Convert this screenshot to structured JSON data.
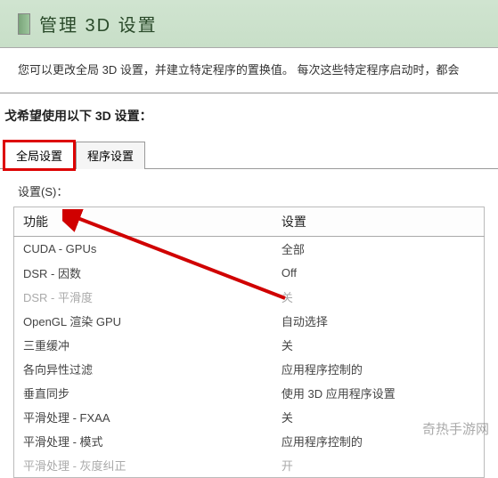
{
  "title": "管理 3D 设置",
  "description": "您可以更改全局 3D 设置，并建立特定程序的置换值。 每次这些特定程序启动时，都会",
  "subsection_label": "戈希望使用以下 3D 设置：",
  "tabs": {
    "global": "全局设置",
    "program": "程序设置"
  },
  "settings_label": "设置(S)：",
  "table": {
    "header_feature": "功能",
    "header_setting": "设置",
    "rows": [
      {
        "feature": "CUDA - GPUs",
        "value": "全部",
        "disabled": false
      },
      {
        "feature": "DSR - 因数",
        "value": "Off",
        "disabled": false
      },
      {
        "feature": "DSR - 平滑度",
        "value": "关",
        "disabled": true
      },
      {
        "feature": "OpenGL 渲染 GPU",
        "value": "自动选择",
        "disabled": false
      },
      {
        "feature": "三重缓冲",
        "value": "关",
        "disabled": false
      },
      {
        "feature": "各向异性过滤",
        "value": "应用程序控制的",
        "disabled": false
      },
      {
        "feature": "垂直同步",
        "value": "使用 3D 应用程序设置",
        "disabled": false
      },
      {
        "feature": "平滑处理 - FXAA",
        "value": "关",
        "disabled": false
      },
      {
        "feature": "平滑处理 - 模式",
        "value": "应用程序控制的",
        "disabled": false
      },
      {
        "feature": "平滑处理 - 灰度纠正",
        "value": "开",
        "disabled": true
      }
    ]
  },
  "watermark": "奇热手游网"
}
